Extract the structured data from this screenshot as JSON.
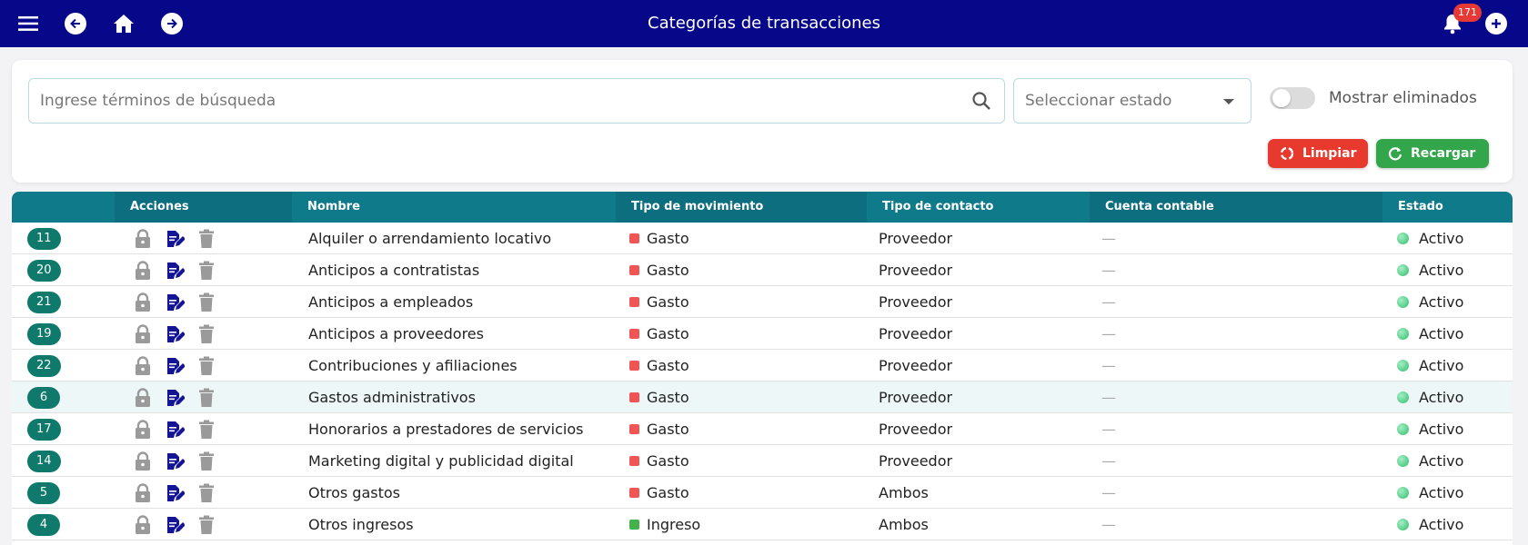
{
  "header": {
    "title": "Categorías de transacciones",
    "notification_count": "171",
    "icons": [
      "menu-icon",
      "back-icon",
      "home-icon",
      "forward-icon",
      "bell-icon",
      "add-icon"
    ]
  },
  "filters": {
    "search_placeholder": "Ingrese términos de búsqueda",
    "state_placeholder": "Seleccionar estado",
    "show_deleted_label": "Mostrar eliminados",
    "show_deleted_on": false,
    "clear_label": "Limpiar",
    "reload_label": "Recargar"
  },
  "table": {
    "columns": {
      "id": "",
      "actions": "Acciones",
      "name": "Nombre",
      "movement": "Tipo de movimiento",
      "contact": "Tipo de contacto",
      "account": "Cuenta contable",
      "state": "Estado"
    },
    "rows": [
      {
        "id": "11",
        "name": "Alquiler o arrendamiento locativo",
        "movement": "Gasto",
        "contact": "Proveedor",
        "account": "—",
        "state": "Activo"
      },
      {
        "id": "20",
        "name": "Anticipos a contratistas",
        "movement": "Gasto",
        "contact": "Proveedor",
        "account": "—",
        "state": "Activo"
      },
      {
        "id": "21",
        "name": "Anticipos a empleados",
        "movement": "Gasto",
        "contact": "Proveedor",
        "account": "—",
        "state": "Activo"
      },
      {
        "id": "19",
        "name": "Anticipos a proveedores",
        "movement": "Gasto",
        "contact": "Proveedor",
        "account": "—",
        "state": "Activo"
      },
      {
        "id": "22",
        "name": "Contribuciones y afiliaciones",
        "movement": "Gasto",
        "contact": "Proveedor",
        "account": "—",
        "state": "Activo"
      },
      {
        "id": "6",
        "name": "Gastos administrativos",
        "movement": "Gasto",
        "contact": "Proveedor",
        "account": "—",
        "state": "Activo"
      },
      {
        "id": "17",
        "name": "Honorarios a prestadores de servicios",
        "movement": "Gasto",
        "contact": "Proveedor",
        "account": "—",
        "state": "Activo"
      },
      {
        "id": "14",
        "name": "Marketing digital y publicidad digital",
        "movement": "Gasto",
        "contact": "Proveedor",
        "account": "—",
        "state": "Activo"
      },
      {
        "id": "5",
        "name": "Otros gastos",
        "movement": "Gasto",
        "contact": "Ambos",
        "account": "—",
        "state": "Activo"
      },
      {
        "id": "4",
        "name": "Otros ingresos",
        "movement": "Ingreso",
        "contact": "Ambos",
        "account": "—",
        "state": "Activo"
      }
    ]
  },
  "colors": {
    "header_bg": "#07078a",
    "table_header_bg": "#0f7a8a",
    "expense": "#f05454",
    "income": "#43b24a",
    "active": "#2fbf6a",
    "clear_button": "#e8392e",
    "reload_button": "#33a64b"
  }
}
